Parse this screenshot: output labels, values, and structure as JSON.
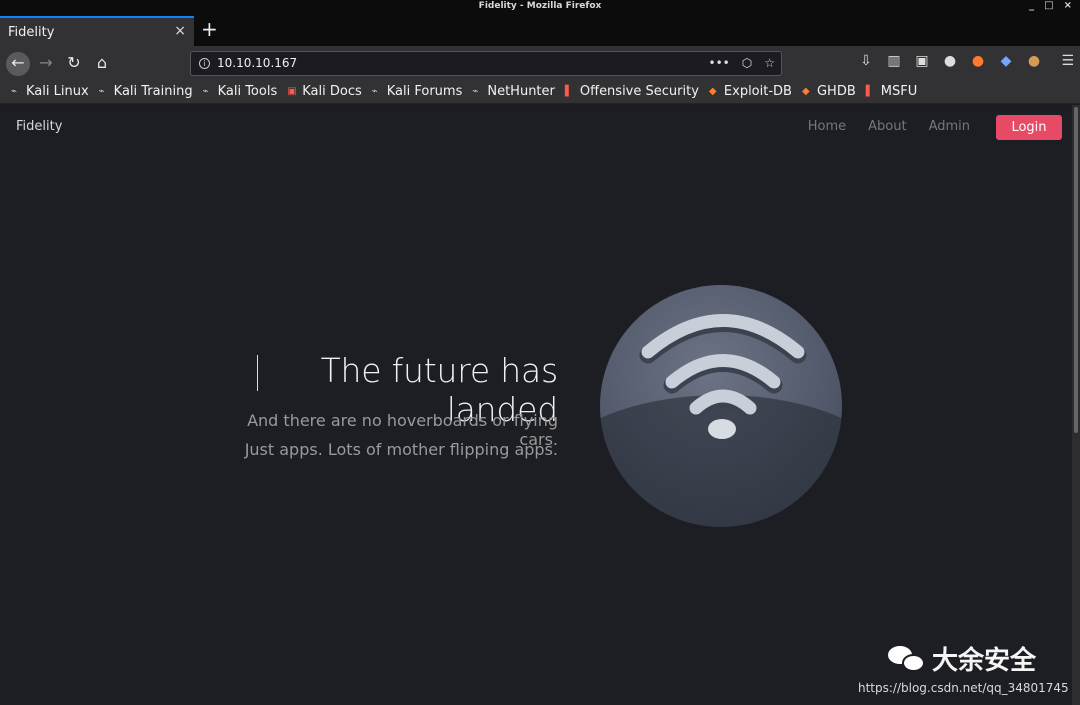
{
  "window": {
    "title": "Fidelity - Mozilla Firefox",
    "buttons": [
      "_",
      "□",
      "×"
    ]
  },
  "tab": {
    "label": "Fidelity",
    "close": "×",
    "new": "+"
  },
  "address": {
    "url": "10.10.10.167",
    "actions": [
      "•••",
      "⬡",
      "☆"
    ]
  },
  "toolbar": {
    "icons": [
      "download-icon",
      "library-icon",
      "sidebar-icon",
      "extension-icon",
      "firefox-icon",
      "translate-icon",
      "cookie-icon"
    ],
    "menu": "☰"
  },
  "bookmarks": [
    {
      "label": "Kali Linux",
      "icon": "kali-icon"
    },
    {
      "label": "Kali Training",
      "icon": "kali-icon"
    },
    {
      "label": "Kali Tools",
      "icon": "kali-icon"
    },
    {
      "label": "Kali Docs",
      "icon": "kali-docs-icon"
    },
    {
      "label": "Kali Forums",
      "icon": "kali-icon"
    },
    {
      "label": "NetHunter",
      "icon": "nethunter-icon"
    },
    {
      "label": "Offensive Security",
      "icon": "offsec-icon"
    },
    {
      "label": "Exploit-DB",
      "icon": "exploitdb-icon"
    },
    {
      "label": "GHDB",
      "icon": "ghdb-icon"
    },
    {
      "label": "MSFU",
      "icon": "msfu-icon"
    }
  ],
  "site": {
    "brand": "Fidelity",
    "nav": [
      "Home",
      "About",
      "Admin"
    ],
    "login": "Login",
    "hero_title": "The future has landed",
    "sub_line_1": "And there are no hoverboards or flying cars.",
    "sub_line_2": "Just apps. Lots of mother flipping apps."
  },
  "watermark": {
    "name": "大余安全",
    "url": "https://blog.csdn.net/qq_34801745"
  }
}
